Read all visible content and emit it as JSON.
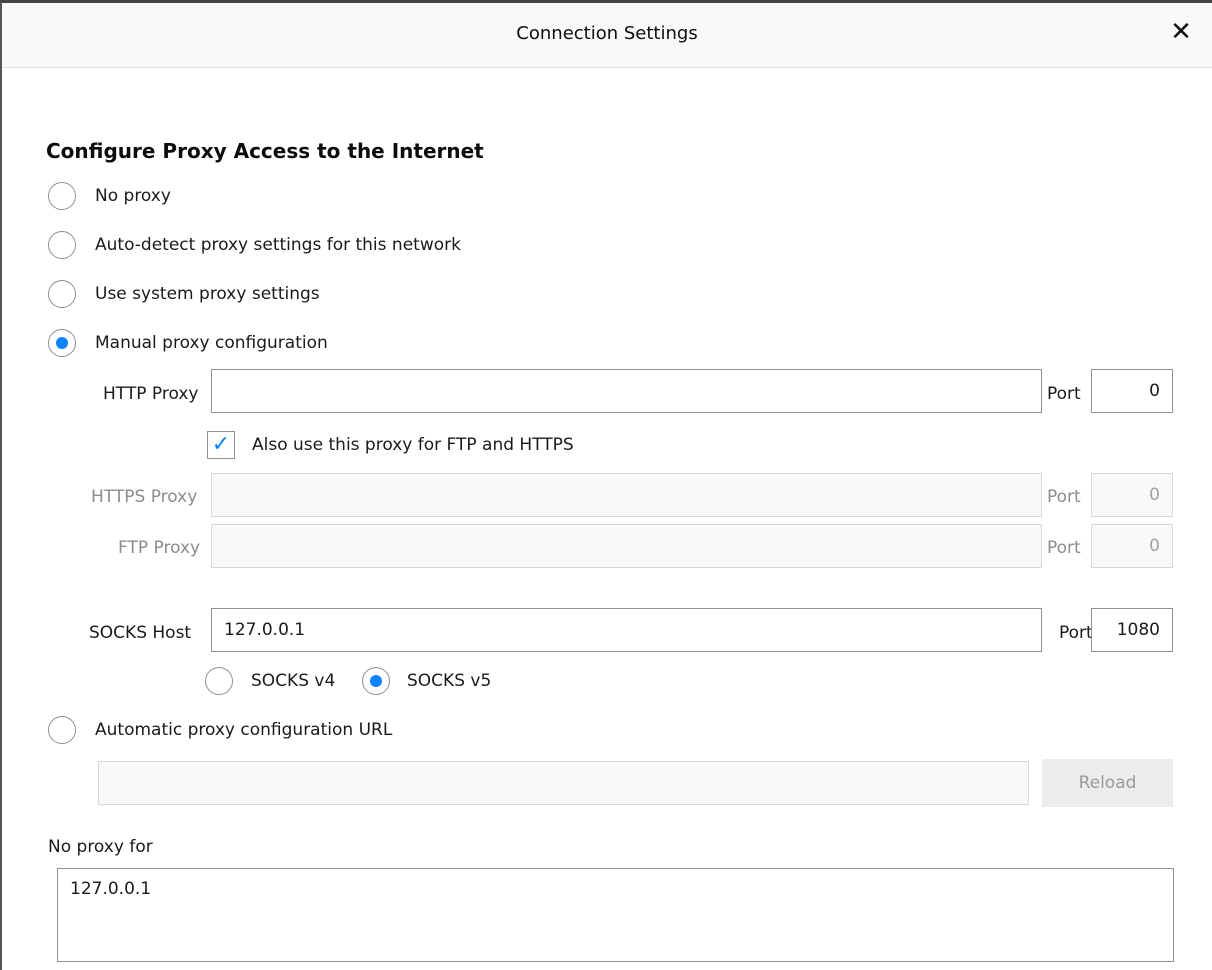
{
  "dialog": {
    "title": "Connection Settings",
    "close_icon": "close-icon"
  },
  "section": {
    "heading": "Configure Proxy Access to the Internet"
  },
  "proxy_options": {
    "no_proxy": "No proxy",
    "auto_detect": "Auto-detect proxy settings for this network",
    "system": "Use system proxy settings",
    "manual": "Manual proxy configuration",
    "auto_url": "Automatic proxy configuration URL",
    "selected": "manual"
  },
  "http": {
    "label": "HTTP Proxy",
    "value": "",
    "port_label": "Port",
    "port": "0"
  },
  "also_use": {
    "label": "Also use this proxy for FTP and HTTPS",
    "checked": true
  },
  "https": {
    "label": "HTTPS Proxy",
    "value": "",
    "port_label": "Port",
    "port": "0"
  },
  "ftp": {
    "label": "FTP Proxy",
    "value": "",
    "port_label": "Port",
    "port": "0"
  },
  "socks": {
    "label": "SOCKS Host",
    "value": "127.0.0.1",
    "port_label": "Port",
    "port": "1080",
    "v4_label": "SOCKS v4",
    "v5_label": "SOCKS v5",
    "selected": "v5"
  },
  "auto_config": {
    "url": "",
    "reload_label": "Reload"
  },
  "no_proxy_for": {
    "label": "No proxy for",
    "value": "127.0.0.1"
  },
  "colors": {
    "accent": "#0a84ff",
    "border": "#8f8f9d",
    "disabled_text": "#8c8c8c"
  }
}
